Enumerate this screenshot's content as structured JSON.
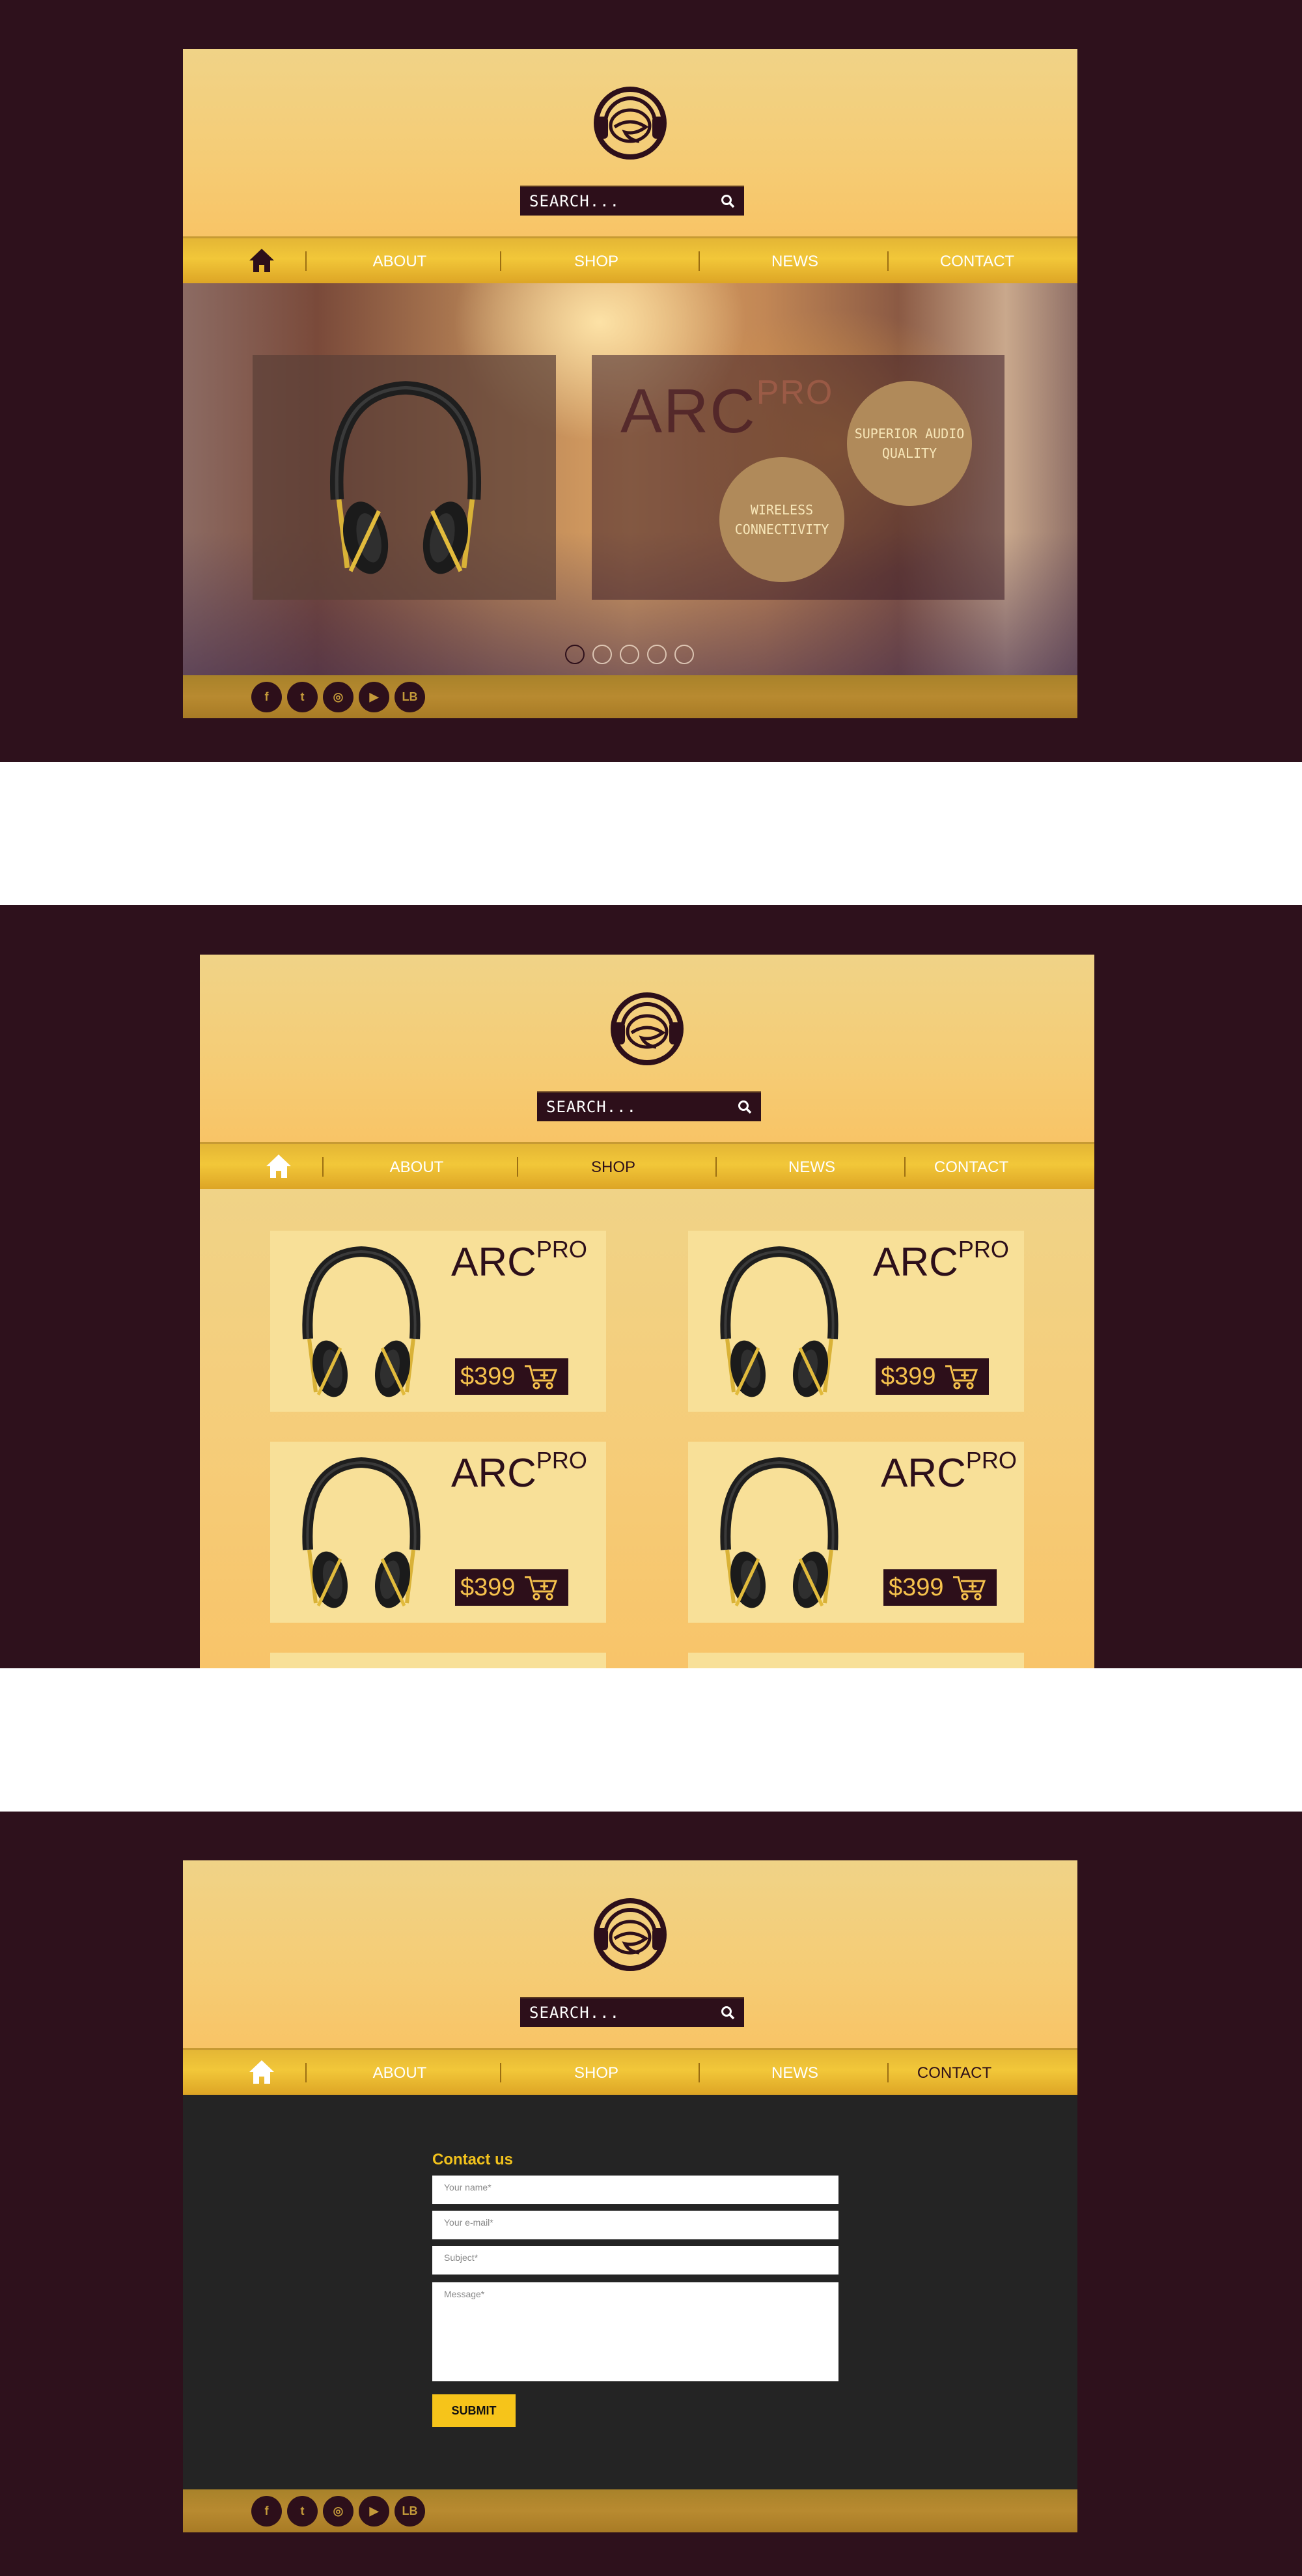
{
  "colors": {
    "background": "#2e111c",
    "accent": "#f2c739",
    "dark": "#2d0f1a",
    "submit": "#f6c41a"
  },
  "header": {
    "search_placeholder": "SEARCH..."
  },
  "nav": {
    "home_icon": "home-icon",
    "items": [
      "ABOUT",
      "SHOP",
      "NEWS",
      "CONTACT"
    ]
  },
  "hero": {
    "product": "ARC",
    "product_sup": "PRO",
    "bubble_1": "SUPERIOR AUDIO QUALITY",
    "bubble_2": "WIRELESS CONNECTIVITY",
    "slides": 5,
    "active_slide": 1
  },
  "socials": [
    "f",
    "t",
    "ig",
    "yt",
    "LB"
  ],
  "shop": {
    "cards": [
      {
        "title": "ARC",
        "sup": "PRO",
        "price": "$399"
      },
      {
        "title": "ARC",
        "sup": "PRO",
        "price": "$399"
      },
      {
        "title": "ARC",
        "sup": "PRO",
        "price": "$399"
      },
      {
        "title": "ARC",
        "sup": "PRO",
        "price": "$399"
      }
    ]
  },
  "contact": {
    "title": "Contact us",
    "name_placeholder": "Your name*",
    "email_placeholder": "Your e-mail*",
    "subject_placeholder": "Subject*",
    "message_placeholder": "Message*",
    "submit_label": "SUBMIT"
  }
}
